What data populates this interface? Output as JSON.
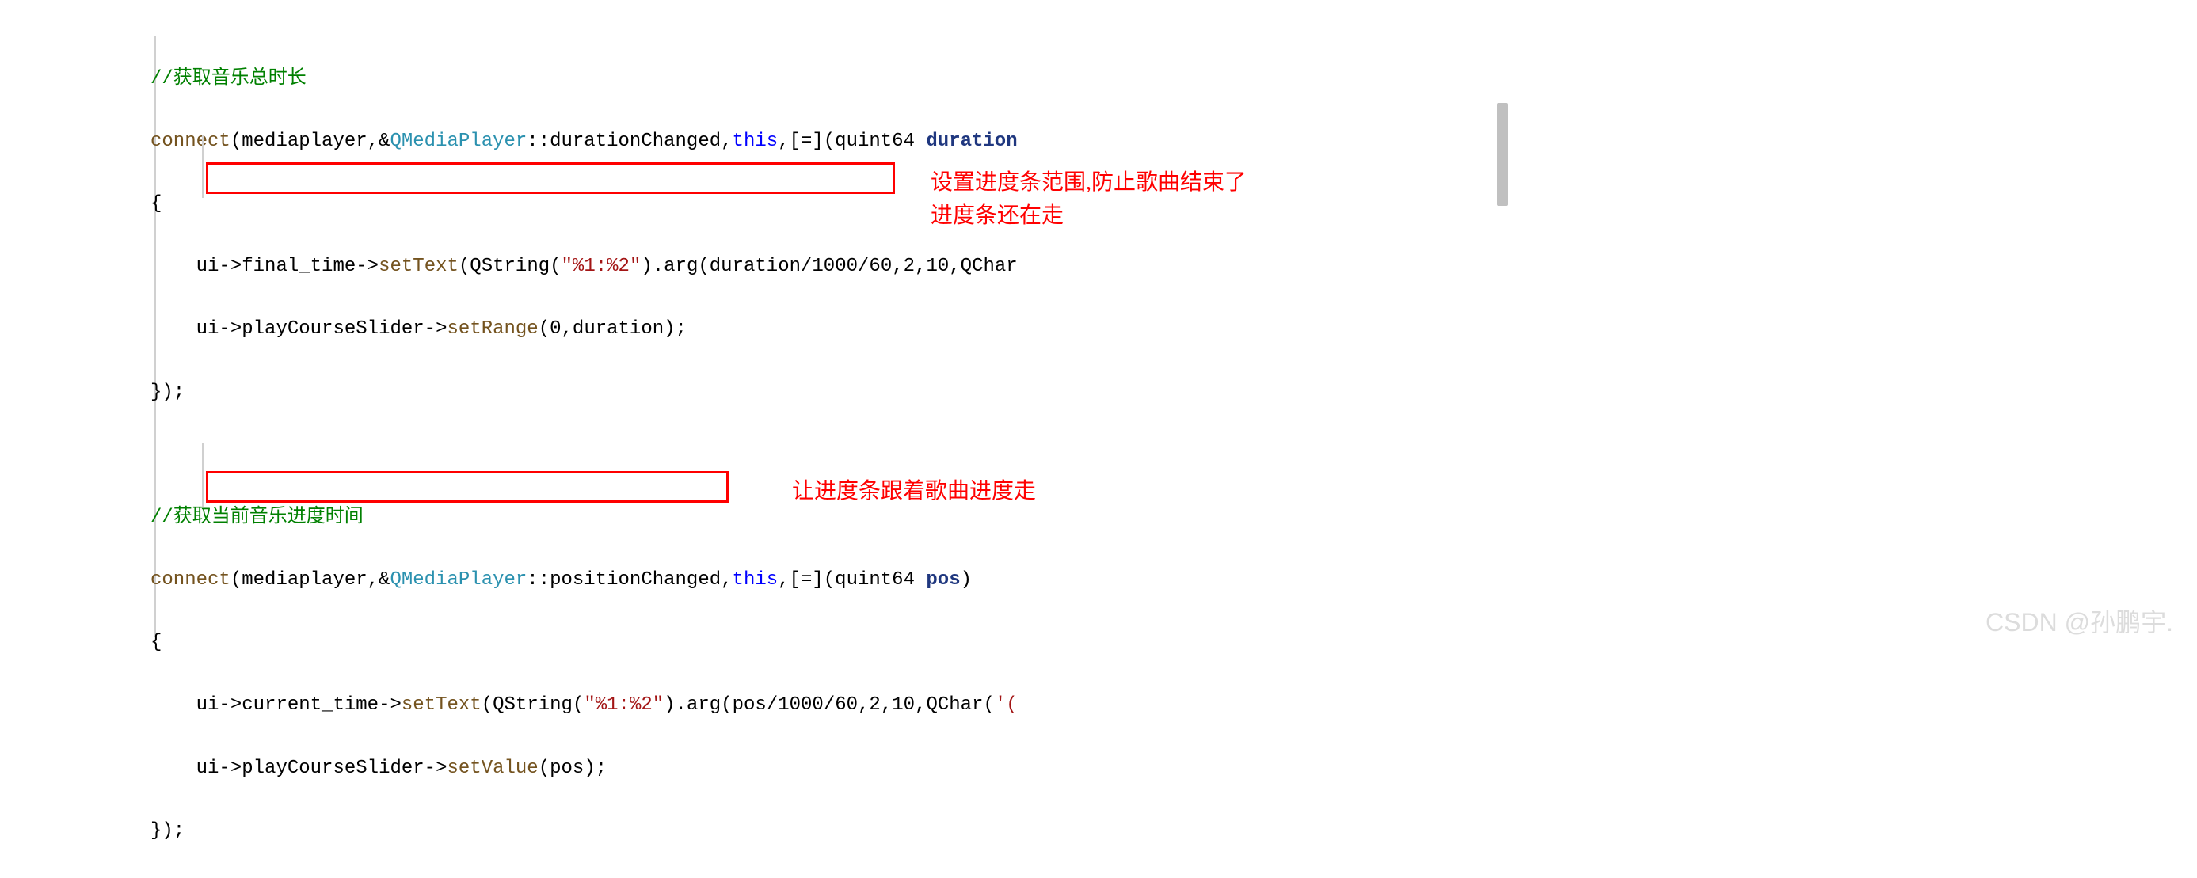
{
  "code": {
    "line1_comment": "//获取音乐总时长",
    "line2_connect": "connect",
    "line2_mediaplayer": "(mediaplayer,&",
    "line2_qmediaplayer": "QMediaPlayer",
    "line2_durationChanged": "::durationChanged,",
    "line2_this": "this",
    "line2_lambda": ",[=](quint64 ",
    "line2_duration": "duration",
    "line3_brace": "{",
    "line4_ui": "ui",
    "line4_arrow1": "->",
    "line4_final_time": "final_time",
    "line4_arrow2": "->",
    "line4_setText": "setText",
    "line4_qstring": "(QString(",
    "line4_str": "\"%1:%2\"",
    "line4_arg": ").arg(duration/",
    "line4_num1": "1000",
    "line4_slash": "/",
    "line4_num2": "60",
    "line4_comma": ",",
    "line4_num3": "2",
    "line4_comma2": ",",
    "line4_num4": "10",
    "line4_qchar": ",QChar",
    "line5_ui": "ui",
    "line5_arrow1": "->",
    "line5_playCourseSlider": "playCourseSlider",
    "line5_arrow2": "->",
    "line5_setRange": "setRange",
    "line5_args": "(",
    "line5_zero": "0",
    "line5_rest": ",duration);",
    "line6_close": "});",
    "line8_comment": "//获取当前音乐进度时间",
    "line9_connect": "connect",
    "line9_mediaplayer": "(mediaplayer,&",
    "line9_qmediaplayer": "QMediaPlayer",
    "line9_positionChanged": "::positionChanged,",
    "line9_this": "this",
    "line9_lambda": ",[=](quint64 ",
    "line9_pos": "pos",
    "line9_close": ")",
    "line10_brace": "{",
    "line11_ui": "ui",
    "line11_arrow1": "->",
    "line11_current_time": "current_time",
    "line11_arrow2": "->",
    "line11_setText": "setText",
    "line11_qstring": "(QString(",
    "line11_str": "\"%1:%2\"",
    "line11_arg": ").arg(pos/",
    "line11_num1": "1000",
    "line11_slash": "/",
    "line11_num2": "60",
    "line11_comma": ",",
    "line11_num3": "2",
    "line11_comma2": ",",
    "line11_num4": "10",
    "line11_qchar": ",QChar(",
    "line11_quote": "'(",
    "line12_ui": "ui",
    "line12_arrow1": "->",
    "line12_playCourseSlider": "playCourseSlider",
    "line12_arrow2": "->",
    "line12_setValue": "setValue",
    "line12_args": "(pos);",
    "line13_close": "});"
  },
  "annotations": {
    "anno1_line1": "设置进度条范围,防止歌曲结束了",
    "anno1_line2": "进度条还在走",
    "anno2": "让进度条跟着歌曲进度走"
  },
  "watermark": "CSDN @孙鹏宇."
}
